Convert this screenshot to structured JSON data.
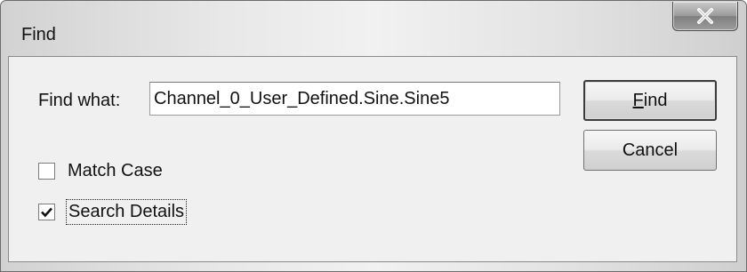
{
  "window": {
    "title": "Find",
    "close_icon": "close-x-icon"
  },
  "find": {
    "label": "Find what:",
    "value": "Channel_0_User_Defined.Sine.Sine5"
  },
  "buttons": {
    "find_mnemonic": "F",
    "find_rest": "ind",
    "cancel": "Cancel"
  },
  "options": {
    "match_case": {
      "label": "Match Case",
      "checked": false
    },
    "search_details": {
      "label": "Search Details",
      "checked": true
    }
  }
}
